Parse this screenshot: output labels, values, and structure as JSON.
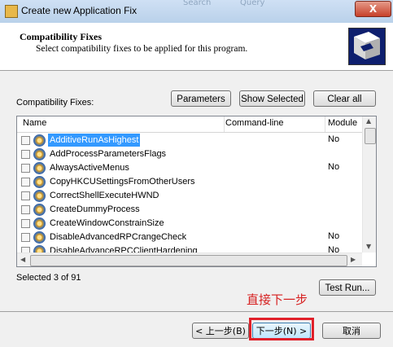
{
  "window": {
    "title": "Create new Application Fix",
    "ghost_items": [
      "Search",
      "Query"
    ],
    "close_label": "X"
  },
  "header": {
    "title": "Compatibility Fixes",
    "subtitle": "Select compatibility fixes to be applied for this program."
  },
  "toolbar": {
    "list_label": "Compatibility Fixes:",
    "parameters_label": "Parameters",
    "show_selected_label": "Show Selected",
    "clear_all_label": "Clear all"
  },
  "table": {
    "columns": [
      "Name",
      "Command-line",
      "Module"
    ],
    "rows": [
      {
        "name": "AdditiveRunAsHighest",
        "module": "No",
        "selected": true
      },
      {
        "name": "AddProcessParametersFlags",
        "module": "",
        "selected": false
      },
      {
        "name": "AlwaysActiveMenus",
        "module": "No",
        "selected": false
      },
      {
        "name": "CopyHKCUSettingsFromOtherUsers",
        "module": "",
        "selected": false
      },
      {
        "name": "CorrectShellExecuteHWND",
        "module": "",
        "selected": false
      },
      {
        "name": "CreateDummyProcess",
        "module": "",
        "selected": false
      },
      {
        "name": "CreateWindowConstrainSize",
        "module": "",
        "selected": false
      },
      {
        "name": "DisableAdvancedRPCrangeCheck",
        "module": "No",
        "selected": false
      },
      {
        "name": "DisableAdvanceRPCClientHardening",
        "module": "No",
        "selected": false
      }
    ]
  },
  "status": {
    "selected_text": "Selected 3 of 91",
    "test_run_label": "Test Run..."
  },
  "annotation": "直接下一步",
  "footer": {
    "back_label": "< 上一步(B)",
    "next_label": "下一步(N) >",
    "cancel_label": "取消"
  }
}
